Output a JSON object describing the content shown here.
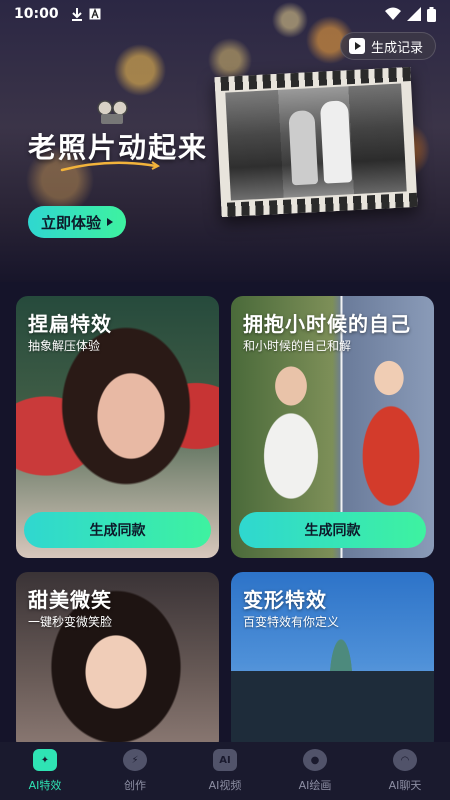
{
  "status_bar": {
    "time": "10:00"
  },
  "banner": {
    "record_button_label": "生成记录",
    "title": "老照片动起来",
    "try_button_label": "立即体验"
  },
  "cards": [
    {
      "title": "捏扁特效",
      "subtitle": "抽象解压体验",
      "button_label": "生成同款"
    },
    {
      "title": "拥抱小时候的自己",
      "subtitle": "和小时候的自己和解",
      "button_label": "生成同款"
    },
    {
      "title": "甜美微笑",
      "subtitle": "一键秒变微笑脸"
    },
    {
      "title": "变形特效",
      "subtitle": "百变特效有你定义"
    }
  ],
  "bottom_nav": {
    "items": [
      {
        "label": "AI特效",
        "icon": "ai-effects-icon",
        "active": true
      },
      {
        "label": "创作",
        "icon": "create-icon"
      },
      {
        "label": "AI视频",
        "icon": "ai-video-icon"
      },
      {
        "label": "AI绘画",
        "icon": "ai-painting-icon"
      },
      {
        "label": "AI聊天",
        "icon": "ai-chat-icon"
      }
    ]
  },
  "colors": {
    "accent_start": "#2fd7d0",
    "accent_end": "#3ef2a0",
    "nav_bg": "#1a1a2e"
  }
}
